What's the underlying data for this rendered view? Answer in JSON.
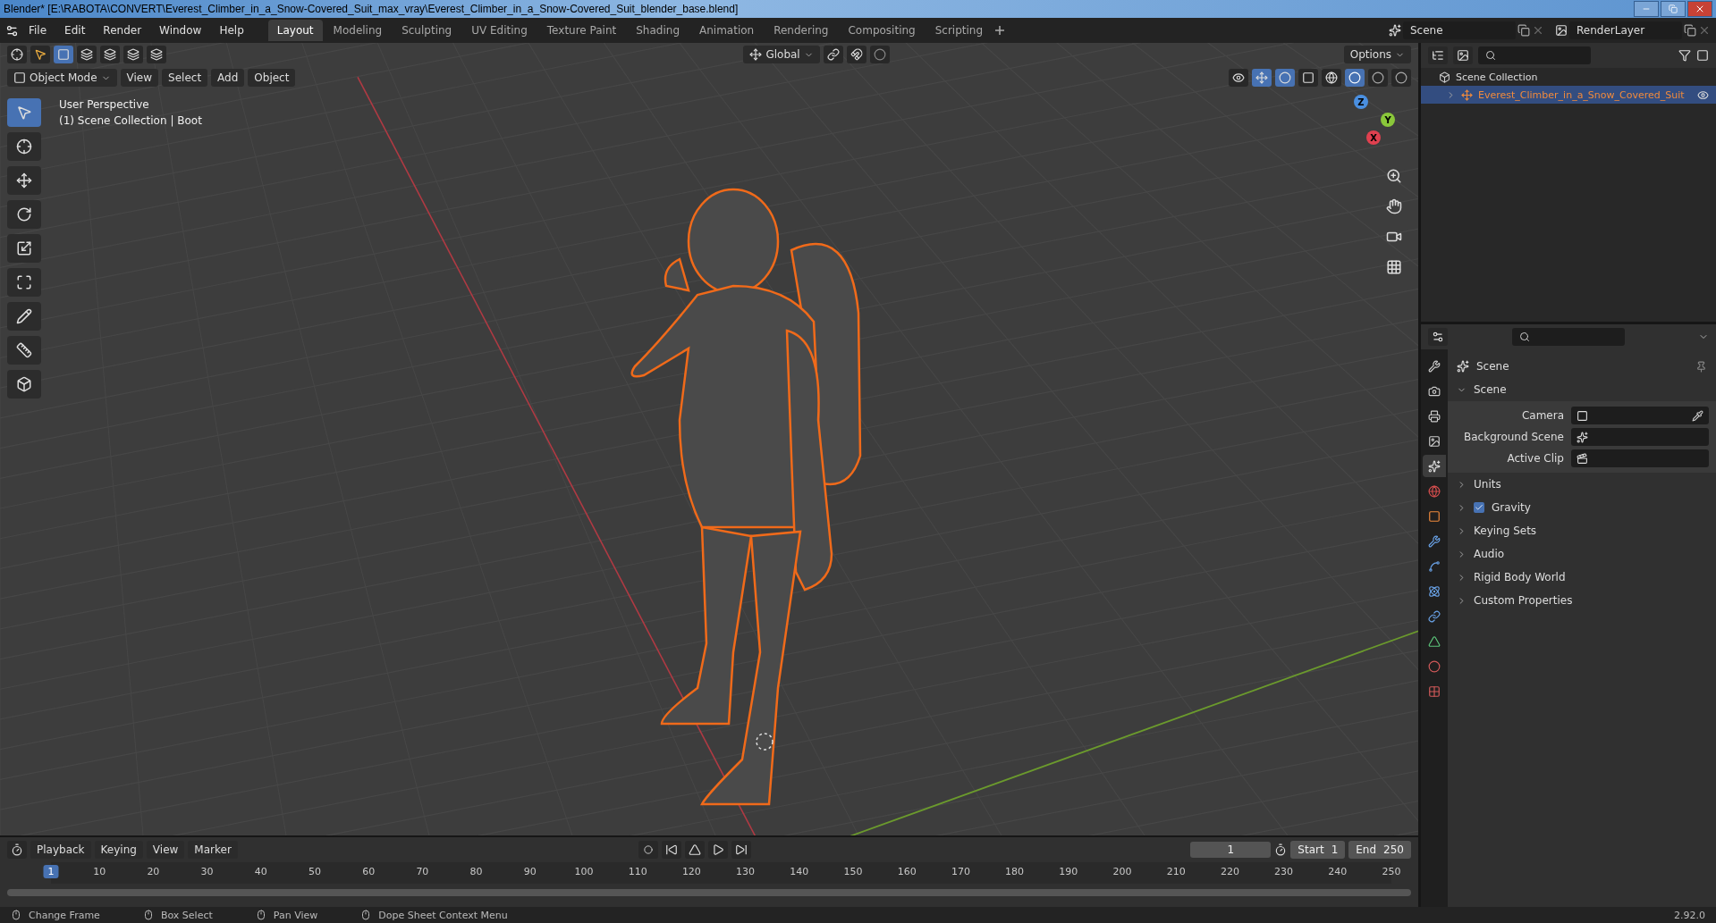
{
  "title_bar": {
    "title": "Blender* [E:\\RABOTA\\CONVERT\\Everest_Climber_in_a_Snow-Covered_Suit_max_vray\\Everest_Climber_in_a_Snow-Covered_Suit_blender_base.blend]"
  },
  "menu": [
    "File",
    "Edit",
    "Render",
    "Window",
    "Help"
  ],
  "workspaces": [
    {
      "label": "Layout",
      "selected": true
    },
    {
      "label": "Modeling",
      "selected": false
    },
    {
      "label": "Sculpting",
      "selected": false
    },
    {
      "label": "UV Editing",
      "selected": false
    },
    {
      "label": "Texture Paint",
      "selected": false
    },
    {
      "label": "Shading",
      "selected": false
    },
    {
      "label": "Animation",
      "selected": false
    },
    {
      "label": "Rendering",
      "selected": false
    },
    {
      "label": "Compositing",
      "selected": false
    },
    {
      "label": "Scripting",
      "selected": false
    }
  ],
  "scene_field": "Scene",
  "view_layer_field": "RenderLayer",
  "viewport": {
    "orientation": "Global",
    "options": "Options",
    "mode": "Object Mode",
    "menus": [
      "View",
      "Select",
      "Add",
      "Object"
    ],
    "overlay_lines": [
      "User Perspective",
      "(1) Scene Collection | Boot"
    ],
    "tools": [
      {
        "kind": "select",
        "selected": true
      },
      {
        "kind": "cursor",
        "selected": false
      },
      {
        "kind": "move",
        "selected": false
      },
      {
        "kind": "rotate",
        "selected": false
      },
      {
        "kind": "scale",
        "selected": false
      },
      {
        "kind": "transform",
        "selected": false
      },
      {
        "kind": "annotate",
        "selected": false
      },
      {
        "kind": "measure",
        "selected": false
      },
      {
        "kind": "add_cube",
        "selected": false
      }
    ],
    "gizmo_axes": [
      "X",
      "Y",
      "Z"
    ]
  },
  "outliner": {
    "root": "Scene Collection",
    "children": [
      {
        "label": "Everest_Climber_in_a_Snow_Covered_Suit",
        "selected": true
      }
    ]
  },
  "properties": {
    "tabs": [
      {
        "kind": "tool",
        "selected": false
      },
      {
        "kind": "render",
        "selected": false
      },
      {
        "kind": "output",
        "selected": false
      },
      {
        "kind": "view_layer",
        "selected": false
      },
      {
        "kind": "scene",
        "selected": true
      },
      {
        "kind": "world",
        "selected": false
      },
      {
        "kind": "object",
        "selected": false
      },
      {
        "kind": "modifier",
        "selected": false
      },
      {
        "kind": "particles",
        "selected": false
      },
      {
        "kind": "physics",
        "selected": false
      },
      {
        "kind": "constraints",
        "selected": false
      },
      {
        "kind": "data",
        "selected": false
      },
      {
        "kind": "material",
        "selected": false
      },
      {
        "kind": "texture",
        "selected": false
      }
    ],
    "context": "Scene",
    "panel": {
      "title": "Scene",
      "expanded": true,
      "fields": [
        {
          "label": "Camera",
          "kind": "camera"
        },
        {
          "label": "Background Scene",
          "kind": "scene"
        },
        {
          "label": "Active Clip",
          "kind": "clip"
        }
      ]
    },
    "sections": [
      {
        "label": "Units",
        "kind": "plain"
      },
      {
        "label": "Gravity",
        "kind": "checkbox",
        "checked": true
      },
      {
        "label": "Keying Sets",
        "kind": "plain"
      },
      {
        "label": "Audio",
        "kind": "plain"
      },
      {
        "label": "Rigid Body World",
        "kind": "plain"
      },
      {
        "label": "Custom Properties",
        "kind": "plain"
      }
    ]
  },
  "timeline": {
    "menus": [
      "Playback",
      "Keying",
      "View",
      "Marker"
    ],
    "current_frame": "1",
    "start_label": "Start",
    "start": "1",
    "end_label": "End",
    "end": "250",
    "ticks": [
      {
        "label": "1",
        "selected": true
      },
      {
        "label": "10",
        "selected": false
      },
      {
        "label": "20",
        "selected": false
      },
      {
        "label": "30",
        "selected": false
      },
      {
        "label": "40",
        "selected": false
      },
      {
        "label": "50",
        "selected": false
      },
      {
        "label": "60",
        "selected": false
      },
      {
        "label": "70",
        "selected": false
      },
      {
        "label": "80",
        "selected": false
      },
      {
        "label": "90",
        "selected": false
      },
      {
        "label": "100",
        "selected": false
      },
      {
        "label": "110",
        "selected": false
      },
      {
        "label": "120",
        "selected": false
      },
      {
        "label": "130",
        "selected": false
      },
      {
        "label": "140",
        "selected": false
      },
      {
        "label": "150",
        "selected": false
      },
      {
        "label": "160",
        "selected": false
      },
      {
        "label": "170",
        "selected": false
      },
      {
        "label": "180",
        "selected": false
      },
      {
        "label": "190",
        "selected": false
      },
      {
        "label": "200",
        "selected": false
      },
      {
        "label": "210",
        "selected": false
      },
      {
        "label": "220",
        "selected": false
      },
      {
        "label": "230",
        "selected": false
      },
      {
        "label": "240",
        "selected": false
      },
      {
        "label": "250",
        "selected": false
      }
    ]
  },
  "status_bar": {
    "hints": [
      "Change Frame",
      "Box Select",
      "Pan View",
      "Dope Sheet Context Menu"
    ],
    "version": "2.92.0"
  }
}
